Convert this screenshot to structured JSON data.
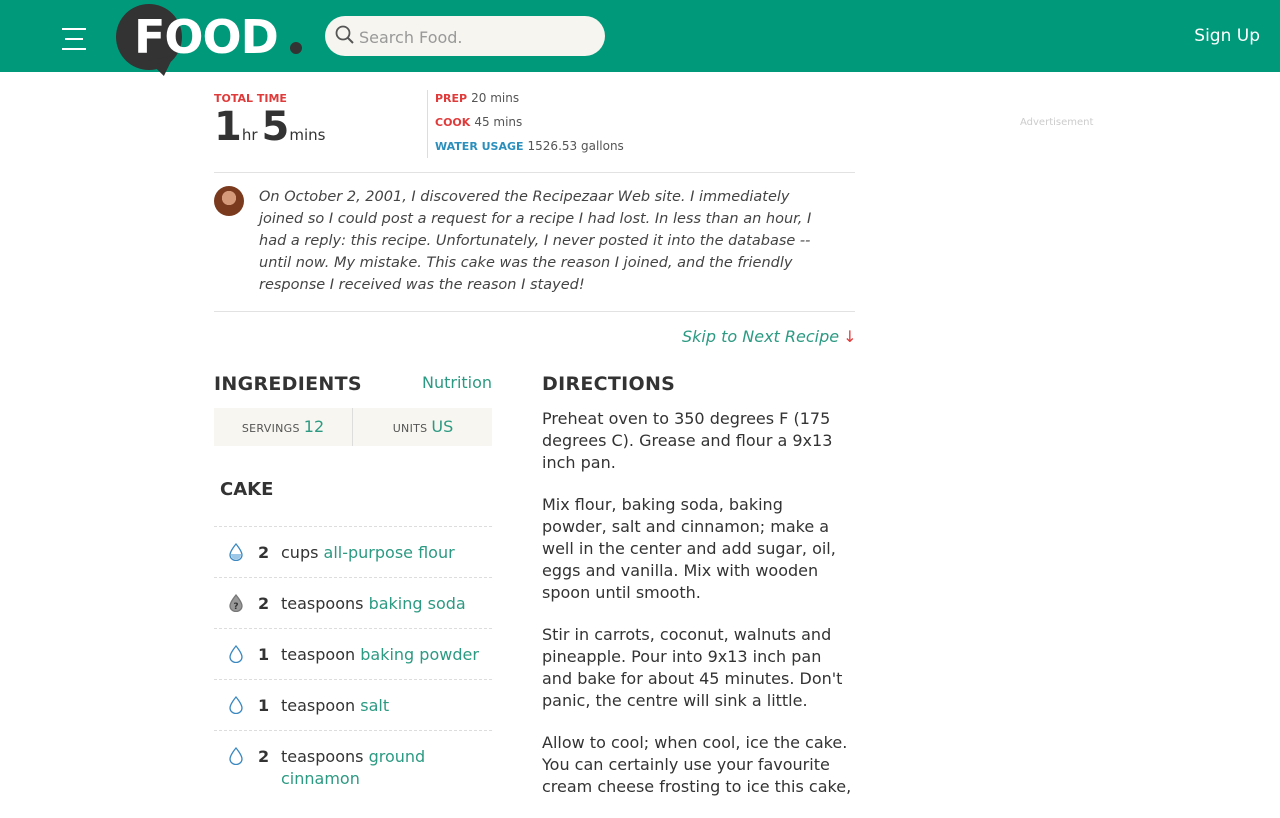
{
  "header": {
    "logo_text": "FOOD",
    "search_placeholder": "Search Food.",
    "signup_label": "Sign Up",
    "brand_color": "#009a7b"
  },
  "times": {
    "total_label": "TOTAL TIME",
    "total_hours": "1",
    "hours_unit": "hr",
    "total_minutes": "5",
    "minutes_unit": "mins",
    "prep_label": "PREP",
    "prep_value": "20 mins",
    "cook_label": "COOK",
    "cook_value": "45 mins",
    "water_label": "WATER USAGE",
    "water_value": "1526.53 gallons"
  },
  "advertisement_label": "Advertisement",
  "description": "On October 2, 2001, I discovered the Recipezaar Web site. I immediately joined so I could post a request for a recipe I had lost. In less than an hour, I had a reply: this recipe. Unfortunately, I never posted it into the database -- until now. My mistake. This cake was the reason I joined, and the friendly response I received was the reason I stayed!",
  "skip_label": "Skip to Next Recipe",
  "skip_arrow": "↓",
  "ingredients": {
    "title": "INGREDIENTS",
    "nutrition_label": "Nutrition",
    "servings_label": "SERVINGS",
    "servings_value": "12",
    "units_label": "UNITS",
    "units_value": "US",
    "section_title": "CAKE",
    "items": [
      {
        "qty": "2",
        "unit": "cups",
        "name": "all-purpose flour",
        "icon": "water-drop-filled-icon"
      },
      {
        "qty": "2",
        "unit": "teaspoons",
        "name": "baking soda",
        "icon": "water-drop-unknown-icon"
      },
      {
        "qty": "1",
        "unit": "teaspoon",
        "name": "baking powder",
        "icon": "water-drop-icon"
      },
      {
        "qty": "1",
        "unit": "teaspoon",
        "name": "salt",
        "icon": "water-drop-icon"
      },
      {
        "qty": "2",
        "unit": "teaspoons",
        "name": "ground cinnamon",
        "icon": "water-drop-icon"
      }
    ]
  },
  "directions": {
    "title": "DIRECTIONS",
    "steps": [
      "Preheat oven to 350 degrees F (175 degrees C). Grease and flour a 9x13 inch pan.",
      "Mix flour, baking soda, baking powder, salt and cinnamon; make a well in the center and add sugar, oil, eggs and vanilla. Mix with wooden spoon until smooth.",
      "Stir in carrots, coconut, walnuts and pineapple. Pour into 9x13 inch pan and bake for about 45 minutes. Don't panic, the centre will sink a little.",
      "Allow to cool; when cool, ice the cake. You can certainly use your favourite cream cheese frosting to ice this cake,"
    ]
  }
}
